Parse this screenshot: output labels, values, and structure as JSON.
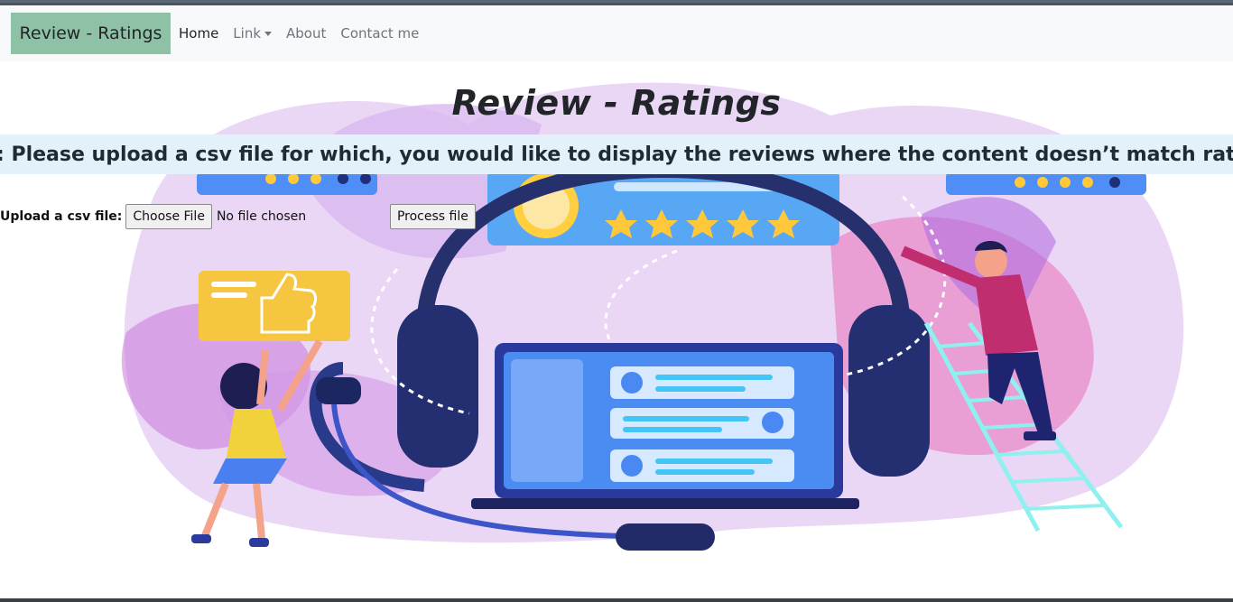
{
  "navbar": {
    "brand": "Review - Ratings",
    "links": [
      {
        "label": "Home",
        "active": true
      },
      {
        "label": "Link",
        "dropdown": true
      },
      {
        "label": "About"
      },
      {
        "label": "Contact me"
      }
    ]
  },
  "main": {
    "title": "Review - Ratings",
    "note": "Note: Please upload a csv file for which, you would like to display the reviews where the content doesn’t match ratings.",
    "upload": {
      "label": "Upload a csv file:",
      "choose_button": "Choose File",
      "status": "No file chosen",
      "process_button": "Process file"
    }
  },
  "colors": {
    "brand_bg": "#8fc1a6",
    "navbar_bg": "#f8f9fa",
    "note_bg": "#e3f1fb"
  }
}
